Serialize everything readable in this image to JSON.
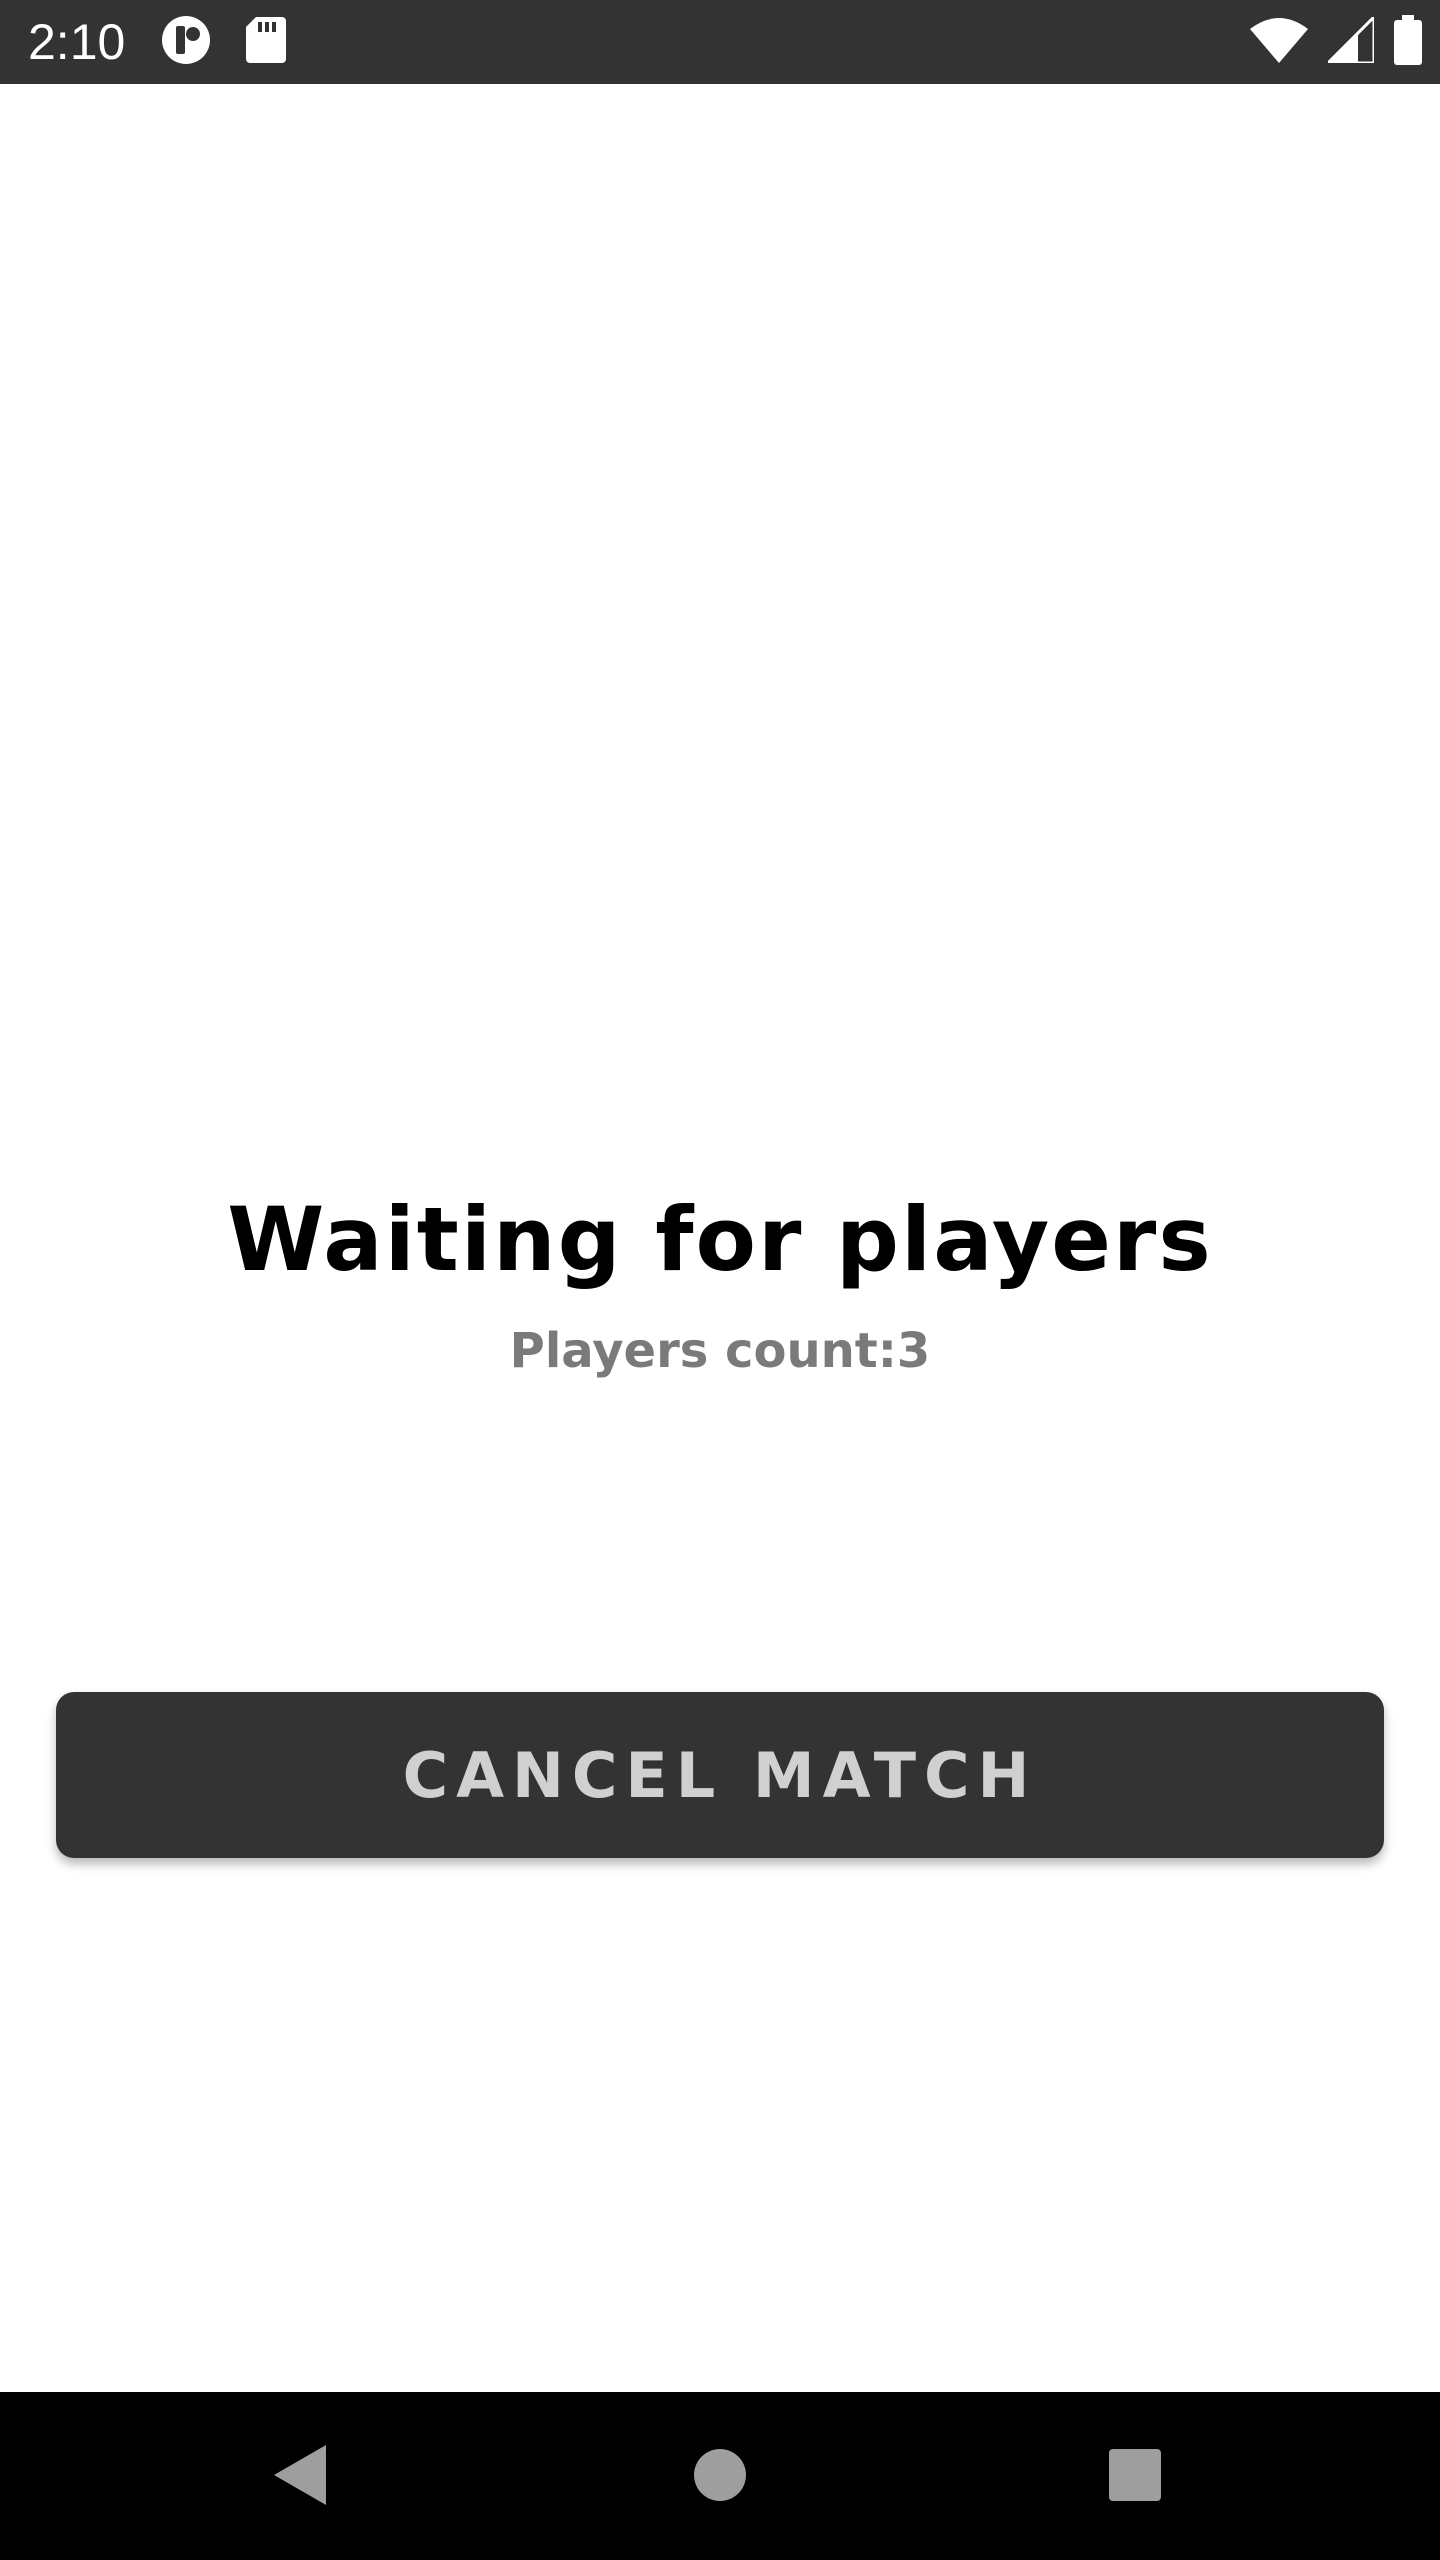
{
  "status_bar": {
    "time": "2:10",
    "left_icons": [
      "circle-app-icon",
      "sd-card-icon"
    ],
    "right_icons": [
      "wifi-icon",
      "cell-signal-icon",
      "battery-icon"
    ]
  },
  "main": {
    "title": "Waiting for players",
    "subtitle": "Players count:3",
    "cancel_button_label": "CANCEL MATCH"
  },
  "nav_bar": {
    "buttons": [
      "back-icon",
      "home-icon",
      "recents-icon"
    ]
  },
  "colors": {
    "status_bar_bg": "#333333",
    "button_bg": "#333333",
    "button_text": "#d0d0d0",
    "subtitle_text": "#7a7a7a",
    "nav_bar_bg": "#000000",
    "nav_icon": "#9e9e9e"
  }
}
